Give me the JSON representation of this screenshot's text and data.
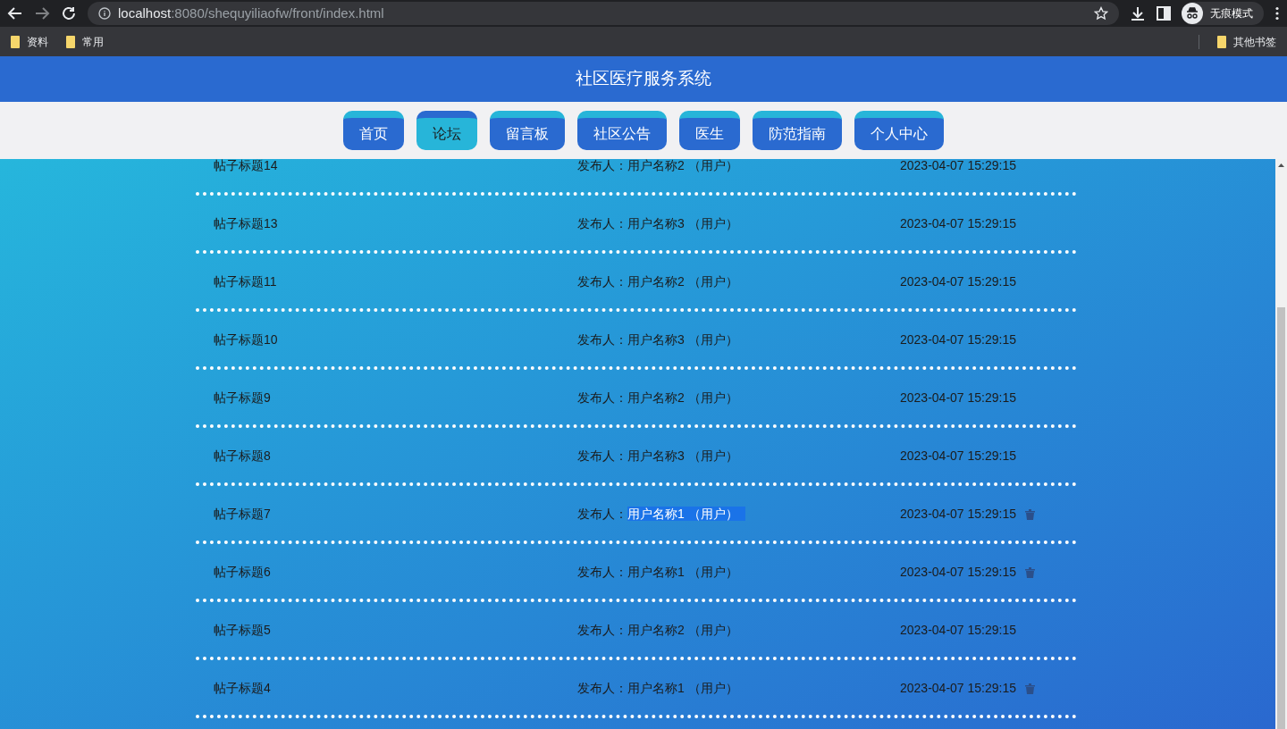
{
  "browser": {
    "url_host": "localhost",
    "url_path": ":8080/shequyiliaofw/front/index.html",
    "bookmarks": [
      "资料",
      "常用"
    ],
    "other_bookmarks": "其他书签",
    "profile": "无痕模式"
  },
  "site_title": "社区医疗服务系统",
  "nav": [
    {
      "label": "首页",
      "selected": false
    },
    {
      "label": "论坛",
      "selected": true
    },
    {
      "label": "留言板",
      "selected": false
    },
    {
      "label": "社区公告",
      "selected": false
    },
    {
      "label": "医生",
      "selected": false
    },
    {
      "label": "防范指南",
      "selected": false
    },
    {
      "label": "个人中心",
      "selected": false
    }
  ],
  "posts": [
    {
      "title": "帖子标题14",
      "author_label": "发布人：",
      "author": "用户名称2 （用户）",
      "time": "2023-04-07 15:29:15",
      "deletable": false,
      "text_selected": false
    },
    {
      "title": "帖子标题13",
      "author_label": "发布人：",
      "author": "用户名称3 （用户）",
      "time": "2023-04-07 15:29:15",
      "deletable": false,
      "text_selected": false
    },
    {
      "title": "帖子标题11",
      "author_label": "发布人：",
      "author": "用户名称2 （用户）",
      "time": "2023-04-07 15:29:15",
      "deletable": false,
      "text_selected": false
    },
    {
      "title": "帖子标题10",
      "author_label": "发布人：",
      "author": "用户名称3 （用户）",
      "time": "2023-04-07 15:29:15",
      "deletable": false,
      "text_selected": false
    },
    {
      "title": "帖子标题9",
      "author_label": "发布人：",
      "author": "用户名称2 （用户）",
      "time": "2023-04-07 15:29:15",
      "deletable": false,
      "text_selected": false
    },
    {
      "title": "帖子标题8",
      "author_label": "发布人：",
      "author": "用户名称3 （用户）",
      "time": "2023-04-07 15:29:15",
      "deletable": false,
      "text_selected": false
    },
    {
      "title": "帖子标题7",
      "author_label": "发布人：",
      "author": "用户名称1 （用户）",
      "time": "2023-04-07 15:29:15",
      "deletable": true,
      "text_selected": true
    },
    {
      "title": "帖子标题6",
      "author_label": "发布人：",
      "author": "用户名称1 （用户）",
      "time": "2023-04-07 15:29:15",
      "deletable": true,
      "text_selected": false
    },
    {
      "title": "帖子标题5",
      "author_label": "发布人：",
      "author": "用户名称2 （用户）",
      "time": "2023-04-07 15:29:15",
      "deletable": false,
      "text_selected": false
    },
    {
      "title": "帖子标题4",
      "author_label": "发布人：",
      "author": "用户名称1 （用户）",
      "time": "2023-04-07 15:29:15",
      "deletable": true,
      "text_selected": false
    }
  ]
}
